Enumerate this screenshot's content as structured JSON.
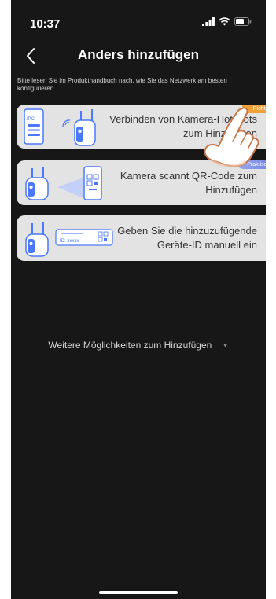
{
  "status_bar": {
    "time": "10:37"
  },
  "header": {
    "title": "Anders hinzufügen"
  },
  "hint": "Bitte lesen Sie im Produkthandbuch nach, wie Sie das Netzwerk am besten konfigurieren",
  "options": [
    {
      "label": "Verbinden von Kamera-Hotspots zum Hinzufügen",
      "badge": "Richtig",
      "illus_text": "IPC"
    },
    {
      "label": "Kamera scannt QR-Code zum Hinzufügen",
      "badge": "Praktisch"
    },
    {
      "label": "Geben Sie die hinzuzufügende Geräte-ID manuell ein",
      "illus_text": "ID: xxxxx"
    }
  ],
  "more_options": "Weitere Möglichkeiten zum Hinzufügen",
  "colors": {
    "background": "#171717",
    "card": "#e3e3e3",
    "badge_orange": "#f0a03a",
    "badge_blue": "#7f8de6",
    "accent": "#4a78ff"
  }
}
